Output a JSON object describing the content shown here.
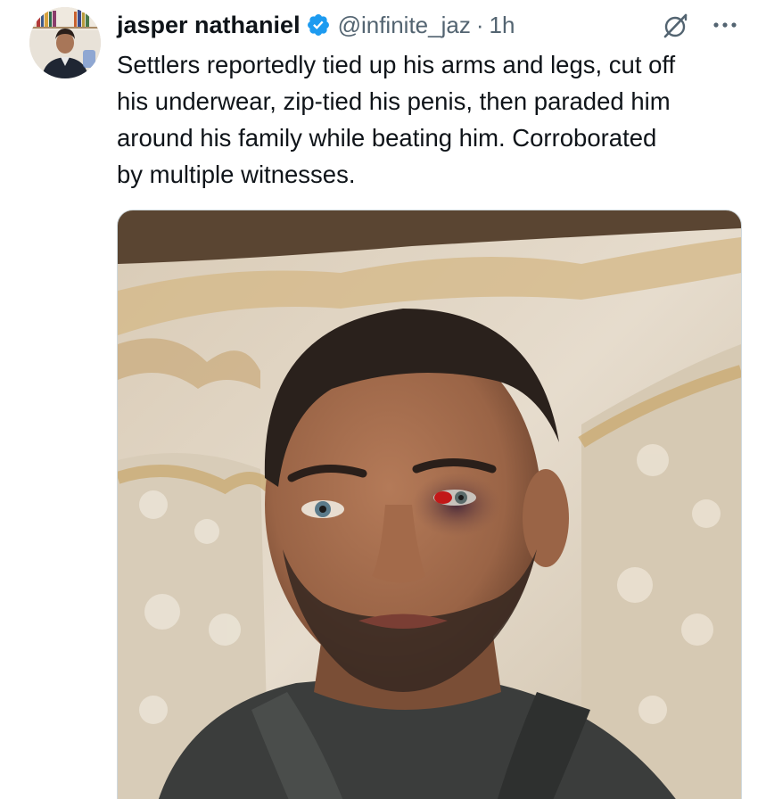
{
  "author": {
    "display_name": "jasper nathaniel",
    "handle": "@infinite_jaz",
    "separator": "·",
    "timestamp": "1h",
    "verified": true,
    "avatar_icon": "profile-photo"
  },
  "tweet": {
    "text": "Settlers reportedly tied up his arms and legs, cut off\nhis underwear, zip-tied his penis, then paraded him\naround his family while beating him. Corroborated\nby multiple witnesses."
  },
  "actions": {
    "grok_icon": "grok-icon",
    "more_icon": "more-icon"
  },
  "colors": {
    "verified_blue": "#1d9bf0",
    "secondary_text": "#536471",
    "primary_text": "#0f1419"
  },
  "media": {
    "type": "photo",
    "subject": "portrait"
  }
}
